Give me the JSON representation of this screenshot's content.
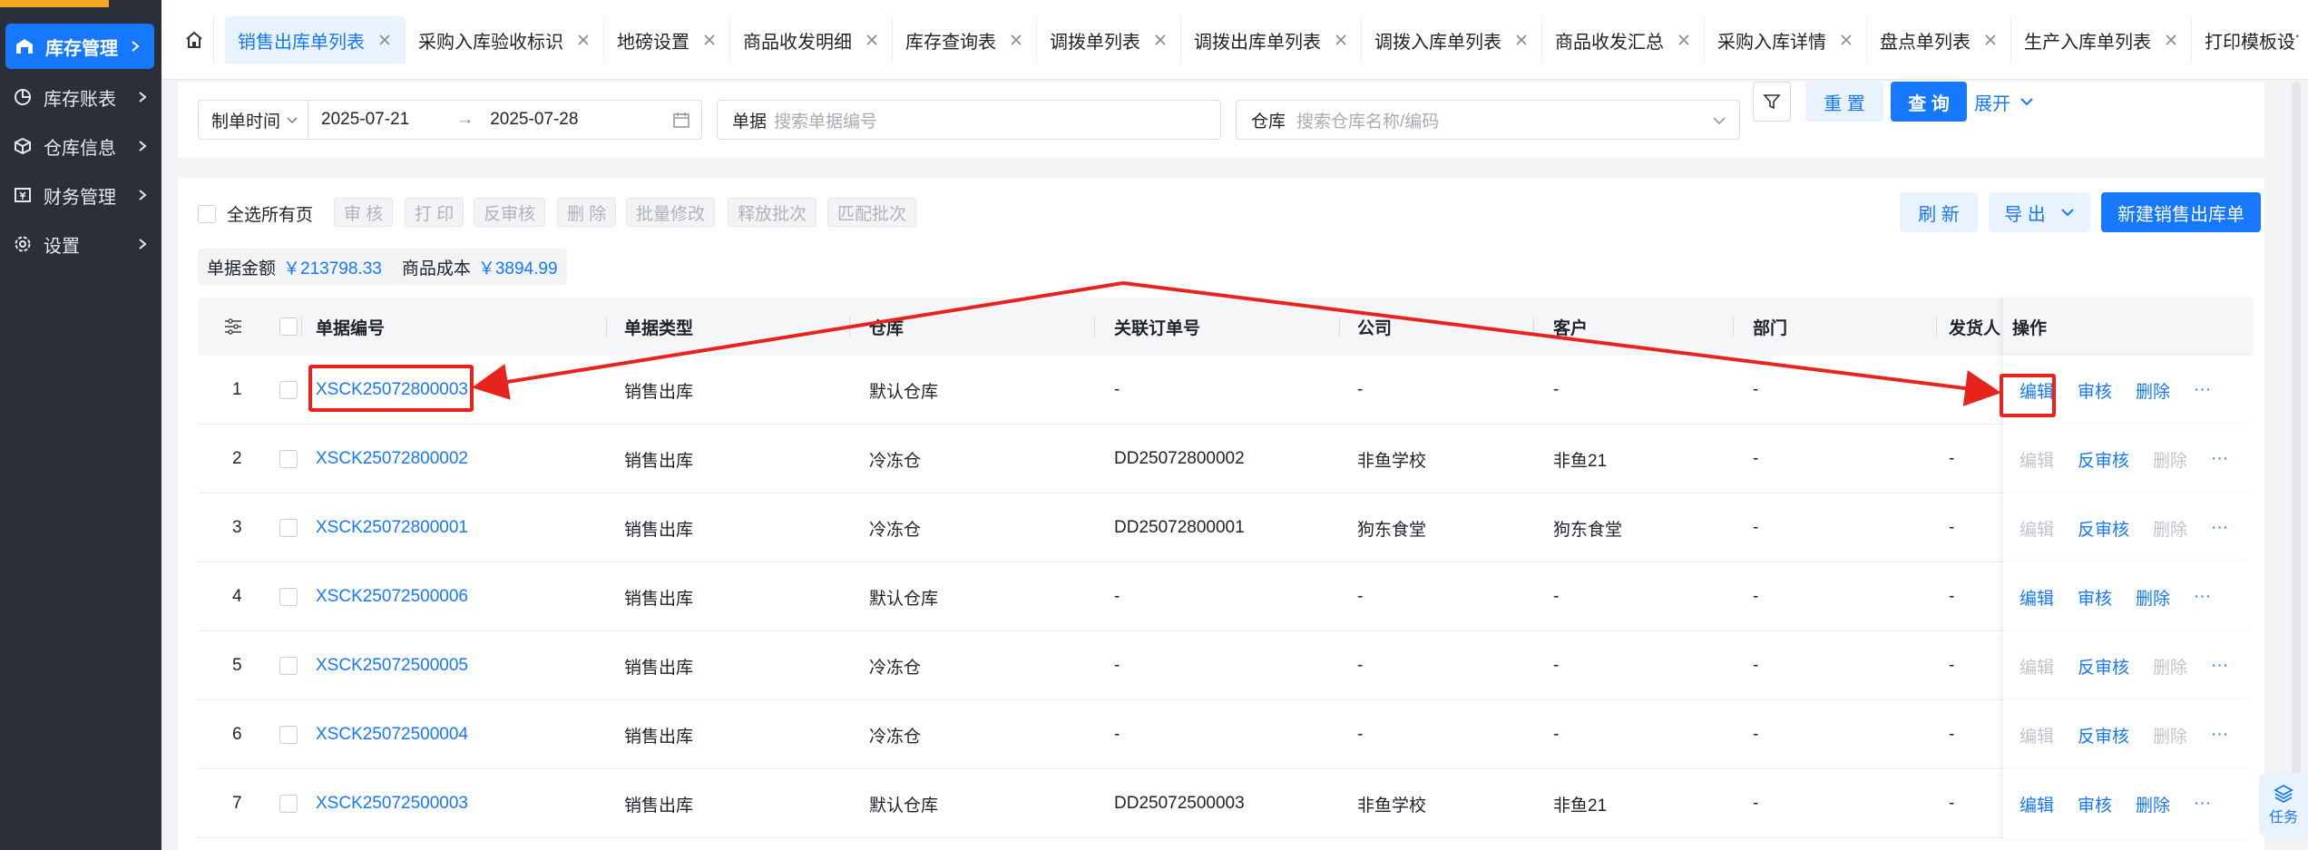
{
  "sidebar": {
    "items": [
      {
        "label": "库存管理",
        "icon": "warehouse-icon",
        "active": true
      },
      {
        "label": "库存账表",
        "icon": "pie-chart-icon",
        "active": false
      },
      {
        "label": "仓库信息",
        "icon": "box-icon",
        "active": false
      },
      {
        "label": "财务管理",
        "icon": "finance-icon",
        "active": false
      },
      {
        "label": "设置",
        "icon": "gear-icon",
        "active": false
      }
    ]
  },
  "tabs": [
    {
      "label": "销售出库单列表",
      "active": true
    },
    {
      "label": "采购入库验收标识",
      "active": false
    },
    {
      "label": "地磅设置",
      "active": false
    },
    {
      "label": "商品收发明细",
      "active": false
    },
    {
      "label": "库存查询表",
      "active": false
    },
    {
      "label": "调拨单列表",
      "active": false
    },
    {
      "label": "调拨出库单列表",
      "active": false
    },
    {
      "label": "调拨入库单列表",
      "active": false
    },
    {
      "label": "商品收发汇总",
      "active": false
    },
    {
      "label": "采购入库详情",
      "active": false
    },
    {
      "label": "盘点单列表",
      "active": false
    },
    {
      "label": "生产入库单列表",
      "active": false
    },
    {
      "label": "打印模板设",
      "active": false
    }
  ],
  "tab_more": "···",
  "filter": {
    "date_type": "制单时间",
    "date_start": "2025-07-21",
    "date_arrow": "→",
    "date_end": "2025-07-28",
    "doc_label": "单据",
    "doc_placeholder": "搜索单据编号",
    "warehouse_label": "仓库",
    "warehouse_placeholder": "搜索仓库名称/编码",
    "reset_label": "重 置",
    "query_label": "查 询",
    "expand_label": "展开"
  },
  "toolbar": {
    "select_all_label": "全选所有页",
    "batch_buttons": [
      "审 核",
      "打 印",
      "反审核",
      "删 除",
      "批量修改",
      "释放批次",
      "匹配批次"
    ],
    "refresh_label": "刷 新",
    "export_label": "导 出",
    "new_label": "新建销售出库单"
  },
  "summary": {
    "amount_label": "单据金额",
    "amount_value": "￥213798.33",
    "cost_label": "商品成本",
    "cost_value": "￥3894.99"
  },
  "table": {
    "columns": [
      "单据编号",
      "单据类型",
      "仓库",
      "关联订单号",
      "公司",
      "客户",
      "部门",
      "发货人",
      "操作"
    ],
    "rows": [
      {
        "index": "1",
        "code": "XSCK25072800003",
        "type": "销售出库",
        "warehouse": "默认仓库",
        "order": "-",
        "company": "-",
        "customer": "-",
        "dept": "-",
        "shipper": "",
        "actions": [
          {
            "label": "编辑",
            "enabled": true
          },
          {
            "label": "审核",
            "enabled": true
          },
          {
            "label": "删除",
            "enabled": true
          }
        ]
      },
      {
        "index": "2",
        "code": "XSCK25072800002",
        "type": "销售出库",
        "warehouse": "冷冻仓",
        "order": "DD25072800002",
        "company": "非鱼学校",
        "customer": "非鱼21",
        "dept": "-",
        "shipper": "-",
        "actions": [
          {
            "label": "编辑",
            "enabled": false
          },
          {
            "label": "反审核",
            "enabled": true
          },
          {
            "label": "删除",
            "enabled": false
          }
        ]
      },
      {
        "index": "3",
        "code": "XSCK25072800001",
        "type": "销售出库",
        "warehouse": "冷冻仓",
        "order": "DD25072800001",
        "company": "狗东食堂",
        "customer": "狗东食堂",
        "dept": "-",
        "shipper": "-",
        "actions": [
          {
            "label": "编辑",
            "enabled": false
          },
          {
            "label": "反审核",
            "enabled": true
          },
          {
            "label": "删除",
            "enabled": false
          }
        ]
      },
      {
        "index": "4",
        "code": "XSCK25072500006",
        "type": "销售出库",
        "warehouse": "默认仓库",
        "order": "-",
        "company": "-",
        "customer": "-",
        "dept": "-",
        "shipper": "-",
        "actions": [
          {
            "label": "编辑",
            "enabled": true
          },
          {
            "label": "审核",
            "enabled": true
          },
          {
            "label": "删除",
            "enabled": true
          }
        ]
      },
      {
        "index": "5",
        "code": "XSCK25072500005",
        "type": "销售出库",
        "warehouse": "冷冻仓",
        "order": "-",
        "company": "-",
        "customer": "-",
        "dept": "-",
        "shipper": "-",
        "actions": [
          {
            "label": "编辑",
            "enabled": false
          },
          {
            "label": "反审核",
            "enabled": true
          },
          {
            "label": "删除",
            "enabled": false
          }
        ]
      },
      {
        "index": "6",
        "code": "XSCK25072500004",
        "type": "销售出库",
        "warehouse": "冷冻仓",
        "order": "-",
        "company": "-",
        "customer": "-",
        "dept": "-",
        "shipper": "-",
        "actions": [
          {
            "label": "编辑",
            "enabled": false
          },
          {
            "label": "反审核",
            "enabled": true
          },
          {
            "label": "删除",
            "enabled": false
          }
        ]
      },
      {
        "index": "7",
        "code": "XSCK25072500003",
        "type": "销售出库",
        "warehouse": "默认仓库",
        "order": "DD25072500003",
        "company": "非鱼学校",
        "customer": "非鱼21",
        "dept": "-",
        "shipper": "-",
        "actions": [
          {
            "label": "编辑",
            "enabled": true
          },
          {
            "label": "审核",
            "enabled": true
          },
          {
            "label": "删除",
            "enabled": true
          }
        ]
      }
    ],
    "more_icon": "···"
  },
  "task_float": {
    "label": "任务",
    "icon": "layers-icon"
  },
  "annotation_color": "#e8231e",
  "accent_color": "#1677ff"
}
